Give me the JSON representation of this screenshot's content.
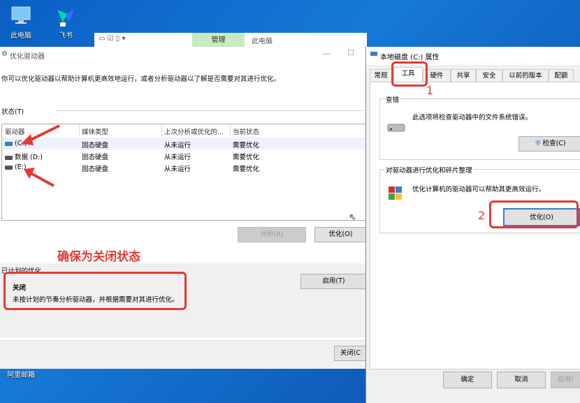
{
  "desktop": {
    "icons": [
      {
        "label": "此电脑"
      },
      {
        "label": "飞书"
      },
      {
        "label": "阿里邮箱"
      }
    ]
  },
  "explorer": {
    "manage_tab": "管理",
    "this_pc_tab": "此电脑"
  },
  "main_window": {
    "title": "优化驱动器",
    "description": "你可以优化驱动器以帮助计算机更高效地运行，或者分析驱动器以了解是否需要对其进行优化。",
    "status_label": "状态(T)",
    "columns": [
      "驱动器",
      "媒体类型",
      "上次分析或优化的...",
      "当前状态"
    ],
    "rows": [
      {
        "drive": "(C:)",
        "media": "固态硬盘",
        "last": "从未运行",
        "status": "需要优化"
      },
      {
        "drive": "数据 (D:)",
        "media": "固态硬盘",
        "last": "从未运行",
        "status": "需要优化"
      },
      {
        "drive": "(E:)",
        "media": "固态硬盘",
        "last": "从未运行",
        "status": "需要优化"
      }
    ],
    "analyze_button": "分析(A)",
    "optimize_button": "优化(O)",
    "scheduled_label": "已计划的优化",
    "schedule_state": "关闭",
    "schedule_desc": "未按计划的节奏分析驱动器，并根据需要对其进行优化。",
    "enable_button": "启用(T)",
    "close_button": "关闭(C"
  },
  "annotations": {
    "ensure_off": "确保为关闭状态",
    "step1": "1",
    "step2": "2"
  },
  "prop_window": {
    "title": "本地磁盘 (C:) 属性",
    "tabs": [
      "常规",
      "工具",
      "硬件",
      "共享",
      "安全",
      "以前的版本",
      "配额"
    ],
    "check_group": "查错",
    "check_desc": "此选项将检查驱动器中的文件系统错误。",
    "check_button": "检查(C)",
    "opt_group": "对驱动器进行优化和碎片整理",
    "opt_desc": "优化计算机的驱动器可以帮助其更高效运行。",
    "opt_button": "优化(O)",
    "ok_button": "确定",
    "cancel_button": "取消",
    "apply_button": "应用("
  },
  "colors": {
    "annotation": "#e53935",
    "desktop": "#1679d6"
  }
}
